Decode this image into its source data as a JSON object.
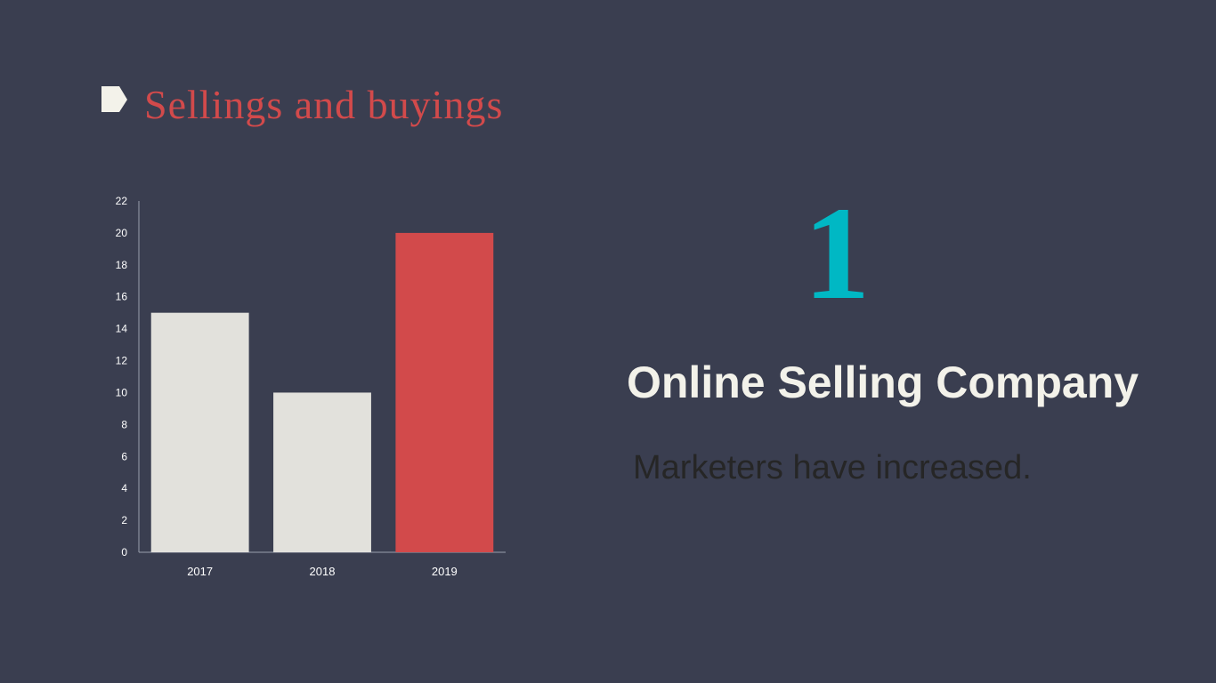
{
  "slide": {
    "title": "Sellings and buyings",
    "title_color": "#d24a4b",
    "marker_color": "#f3f2ea",
    "number": "1",
    "number_color": "#00b8c4",
    "company_name": "Online Selling Company",
    "subtitle": "Marketers have increased.",
    "subtitle_color": "#262626",
    "background": "#3a3e50"
  },
  "chart_data": {
    "type": "bar",
    "categories": [
      "2017",
      "2018",
      "2019"
    ],
    "values": [
      15,
      10,
      20
    ],
    "bar_colors": [
      "#e2e1dc",
      "#e2e1dc",
      "#d24a4b"
    ],
    "title": "",
    "xlabel": "",
    "ylabel": "",
    "ylim": [
      0,
      22
    ],
    "yticks": [
      0,
      2,
      4,
      6,
      8,
      10,
      12,
      14,
      16,
      18,
      20,
      22
    ],
    "grid": false,
    "legend": "none",
    "axis_color": "#9aa0ae",
    "tick_label_color": "#ffffff"
  }
}
